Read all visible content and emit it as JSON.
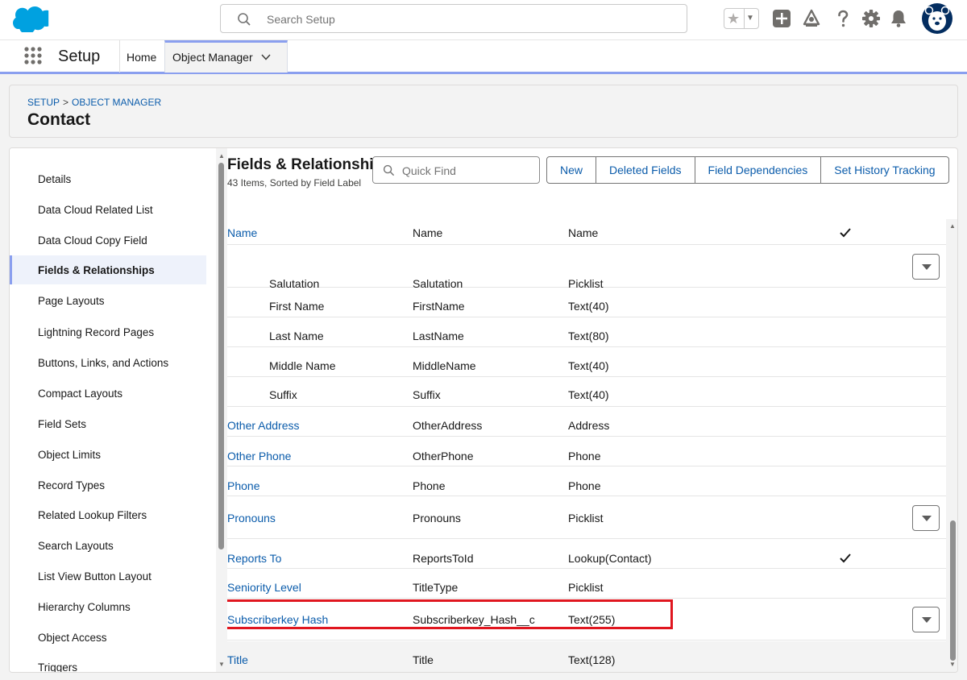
{
  "header": {
    "search_placeholder": "Search Setup",
    "icons": [
      "salesforce-cloud-logo",
      "star-icon",
      "add-icon",
      "trailhead-icon",
      "help-icon",
      "gear-icon",
      "bell-icon",
      "avatar"
    ]
  },
  "nav": {
    "app_name": "Setup",
    "home": "Home",
    "object_manager": "Object Manager"
  },
  "breadcrumb": {
    "setup": "SETUP",
    "sep": ">",
    "object_manager": "OBJECT MANAGER"
  },
  "page_title": "Contact",
  "sidebar": {
    "items": [
      "Details",
      "Data Cloud Related List",
      "Data Cloud Copy Field",
      "Fields & Relationships",
      "Page Layouts",
      "Lightning Record Pages",
      "Buttons, Links, and Actions",
      "Compact Layouts",
      "Field Sets",
      "Object Limits",
      "Record Types",
      "Related Lookup Filters",
      "Search Layouts",
      "List View Button Layout",
      "Hierarchy Columns",
      "Object Access",
      "Triggers"
    ],
    "active_index": 3
  },
  "section": {
    "title": "Fields & Relationships",
    "subtitle": "43 Items, Sorted by Field Label",
    "quick_find_placeholder": "Quick Find",
    "buttons": [
      "New",
      "Deleted Fields",
      "Field Dependencies",
      "Set History Tracking"
    ]
  },
  "rows": [
    {
      "label": "Name",
      "api": "Name",
      "type": "Name",
      "check": "✓"
    },
    {
      "label": "Salutation",
      "api": "Salutation",
      "type": "Picklist",
      "check": ""
    },
    {
      "label": "First Name",
      "api": "FirstName",
      "type": "Text(40)",
      "check": ""
    },
    {
      "label": "Last Name",
      "api": "LastName",
      "type": "Text(80)",
      "check": ""
    },
    {
      "label": "Middle Name",
      "api": "MiddleName",
      "type": "Text(40)",
      "check": ""
    },
    {
      "label": "Suffix",
      "api": "Suffix",
      "type": "Text(40)",
      "check": ""
    },
    {
      "label": "Other Address",
      "api": "OtherAddress",
      "type": "Address",
      "check": ""
    },
    {
      "label": "Other Phone",
      "api": "OtherPhone",
      "type": "Phone",
      "check": ""
    },
    {
      "label": "Phone",
      "api": "Phone",
      "type": "Phone",
      "check": ""
    },
    {
      "label": "Pronouns",
      "api": "Pronouns",
      "type": "Picklist",
      "check": ""
    },
    {
      "label": "Reports To",
      "api": "ReportsToId",
      "type": "Lookup(Contact)",
      "check": "✓"
    },
    {
      "label": "Seniority Level",
      "api": "TitleType",
      "type": "Picklist",
      "check": ""
    },
    {
      "label": "Subscriberkey Hash",
      "api": "Subscriberkey_Hash__c",
      "type": "Text(255)",
      "check": ""
    },
    {
      "label": "Title",
      "api": "Title",
      "type": "Text(128)",
      "check": ""
    }
  ],
  "colors": {
    "link": "#0b5cab",
    "highlight": "#e0161f",
    "accent": "#8a9fef"
  }
}
